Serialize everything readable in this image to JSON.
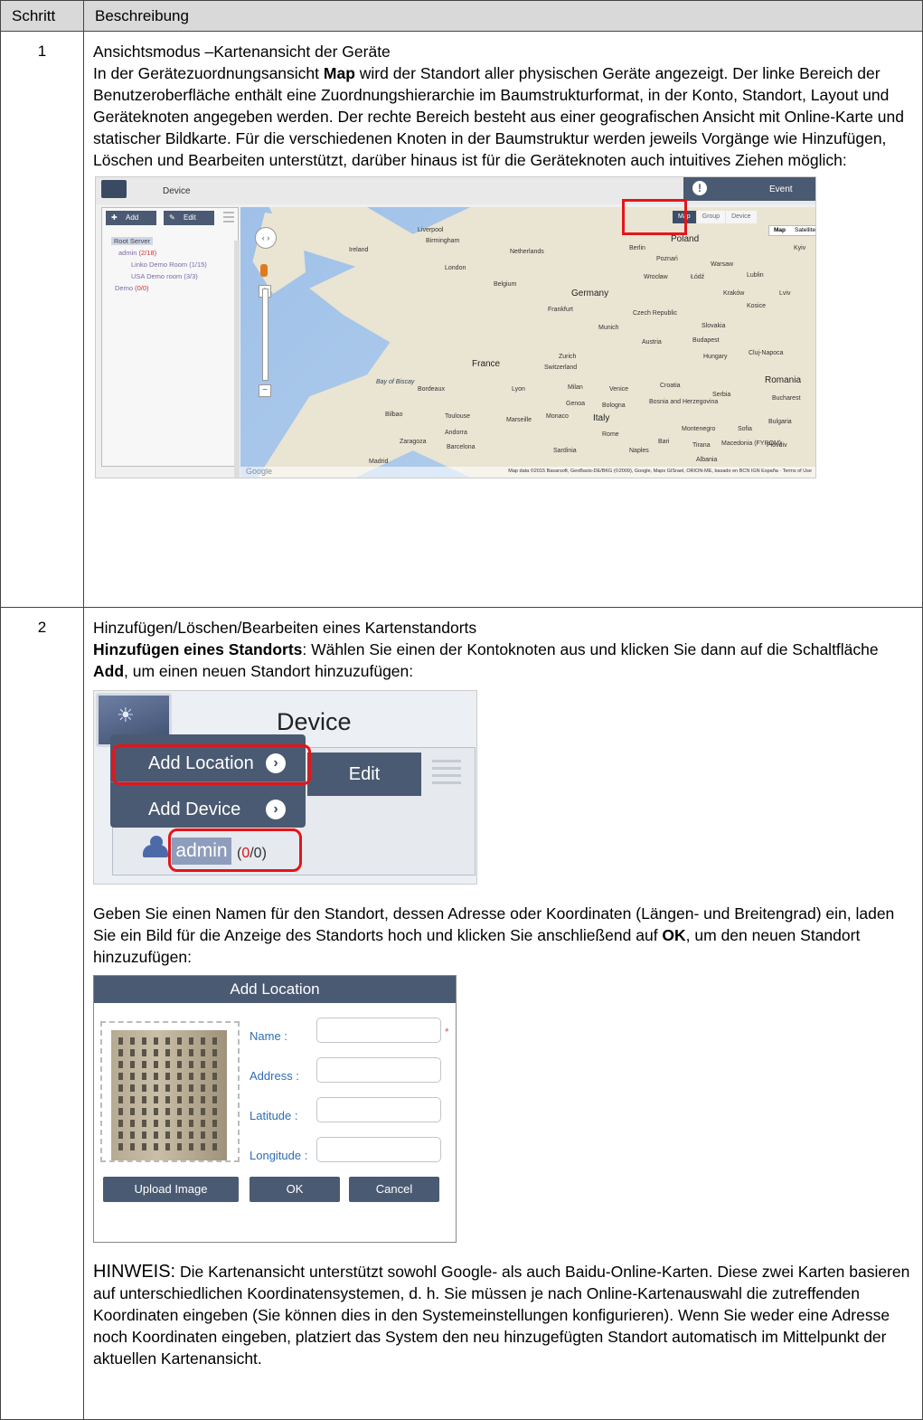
{
  "header": {
    "col_step": "Schritt",
    "col_desc": "Beschreibung"
  },
  "step1": {
    "number": "1",
    "title": "Ansichtsmodus –Kartenansicht der Geräte",
    "text_pre": "In der Gerätezuordnungsansicht ",
    "text_bold": "Map",
    "text_post": " wird der Standort aller physischen Geräte angezeigt. Der linke Bereich der Benutzeroberfläche enthält eine Zuordnungshierarchie im Baumstrukturformat, in der Konto, Standort, Layout und Geräteknoten angegeben werden. Der rechte Bereich besteht aus einer geografischen Ansicht mit Online-Karte und statischer Bildkarte. Für die verschiedenen Knoten in der Baumstruktur werden jeweils Vorgänge wie Hinzufügen, Löschen und Bearbeiten unterstützt, darüber hinaus ist für die Geräteknoten auch intuitives Ziehen möglich:",
    "screenshot": {
      "device_label": "Device",
      "event_label": "Event",
      "add_btn": "Add",
      "edit_btn": "Edit",
      "view_tabs": [
        "Map",
        "Group",
        "Device"
      ],
      "map_type": [
        "Map",
        "Satellite"
      ],
      "tree": {
        "root": "Root Server",
        "admin": "admin",
        "admin_count": "(2/18)",
        "child1": "Linko Demo Room (1/15)",
        "child2": "USA Demo room (3/3)",
        "demo": "Demo",
        "demo_count": "(0/0)"
      },
      "countries": [
        "Poland",
        "Germany",
        "France",
        "Italy",
        "Romania"
      ],
      "cities": [
        "Ireland",
        "Liverpool",
        "Birmingham",
        "London",
        "Netherlands",
        "Belgium",
        "Frankfurt",
        "Berlin",
        "Poznań",
        "Warsaw",
        "Wrocław",
        "Łódź",
        "Lublin",
        "Czech Republic",
        "Slovakia",
        "Austria",
        "Hungary",
        "Budapest",
        "Munich",
        "Zurich",
        "Switzerland",
        "Lyon",
        "Milan",
        "Venice",
        "Croatia",
        "Serbia",
        "Genoa",
        "Bologna",
        "Bordeaux",
        "Toulouse",
        "Marseille",
        "Monaco",
        "Bilbao",
        "Zaragoza",
        "Barcelona",
        "Madrid",
        "Andorra",
        "Sardinia",
        "Rome",
        "Naples",
        "Bulgaria",
        "Bucharest",
        "Sofia",
        "Cluj-Napoca",
        "Bosnia and Herzegovina",
        "Montenegro",
        "Albania",
        "Macedonia (FYROM)",
        "Plovdiv",
        "Bari",
        "Tirana",
        "Kosice",
        "Kraków",
        "Lviv",
        "Kyiv"
      ],
      "sea": "Bay of Biscay",
      "copyright": "Map data ©2015 Basarsoft, GeoBasis-DE/BKG (©2009), Google, Maps GISrael, ORION-ME, basado en BCN IGN España · Terms of Use",
      "google": "Google"
    }
  },
  "step2": {
    "number": "2",
    "title": "Hinzufügen/Löschen/Bearbeiten eines Kartenstandorts",
    "sub_bold": "Hinzufügen eines Standorts",
    "sub_text_pre": ": Wählen Sie einen der Kontoknoten aus und klicken Sie dann auf die Schaltfläche ",
    "sub_text_bold": "Add",
    "sub_text_post": ", um einen neuen Standort hinzuzufügen:",
    "screenshot_menu": {
      "device_label": "Device",
      "menu_items": [
        "Add Location",
        "Add Device"
      ],
      "edit_label": "Edit",
      "admin_label": "admin",
      "count_red": "0",
      "count_rest": "/0"
    },
    "para2_pre": "Geben Sie einen Namen für den Standort, dessen Adresse oder Koordinaten (Längen- und Breitengrad) ein, laden Sie ein Bild für die Anzeige des Standorts hoch und klicken Sie anschließend auf ",
    "para2_bold": "OK",
    "para2_post": ", um den neuen Standort hinzuzufügen:",
    "dialog": {
      "title": "Add Location",
      "fields": [
        "Name :",
        "Address :",
        "Latitude :",
        "Longitude :"
      ],
      "required_mark": "*",
      "buttons": [
        "Upload Image",
        "OK",
        "Cancel"
      ]
    },
    "note_label": "HINWEIS:",
    "note_text": " Die Kartenansicht unterstützt sowohl Google- als auch Baidu-Online-Karten. Diese zwei Karten basieren auf unterschiedlichen Koordinatensystemen, d. h. Sie müssen je nach Online-Kartenauswahl die zutreffenden Koordinaten eingeben (Sie können dies in den Systemeinstellungen konfigurieren). Wenn Sie weder eine Adresse noch Koordinaten eingeben, platziert das System den neu hinzugefügten Standort automatisch im Mittelpunkt der aktuellen Kartenansicht."
  }
}
